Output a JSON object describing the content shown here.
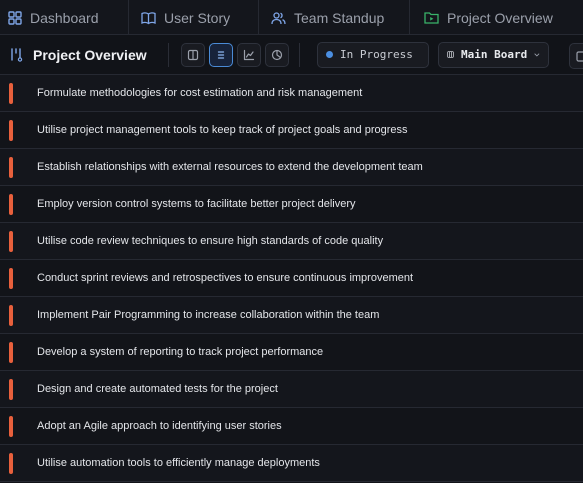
{
  "tabs": [
    {
      "label": "Dashboard",
      "icon": "grid-icon",
      "color": "#7fa6e8"
    },
    {
      "label": "User Story",
      "icon": "book-icon",
      "color": "#7fa6e8"
    },
    {
      "label": "Team Standup",
      "icon": "users-icon",
      "color": "#7fa6e8"
    },
    {
      "label": "Project Overview",
      "icon": "folder-play-icon",
      "color": "#39b36a"
    }
  ],
  "header": {
    "title": "Project Overview",
    "title_icon": "kanban-icon",
    "views": [
      "columns-view-icon",
      "list-view-icon",
      "chart-view-icon",
      "pie-view-icon"
    ],
    "active_view": "list-view-icon",
    "status": {
      "label": "In Progress",
      "color": "#4b8fe2"
    },
    "board": {
      "label": "Main Board"
    }
  },
  "tasks": [
    {
      "label": "Formulate methodologies for cost estimation and risk management",
      "color": "#e8603c"
    },
    {
      "label": "Utilise project management tools to keep track of project goals and progress",
      "color": "#e8603c"
    },
    {
      "label": "Establish relationships with external resources to extend the development team",
      "color": "#e8603c"
    },
    {
      "label": "Employ version control systems to facilitate better project delivery",
      "color": "#e8603c"
    },
    {
      "label": "Utilise code review techniques to ensure high standards of code quality",
      "color": "#e8603c"
    },
    {
      "label": "Conduct sprint reviews and retrospectives to ensure continuous improvement",
      "color": "#e8603c"
    },
    {
      "label": "Implement Pair Programming to increase collaboration within the team",
      "color": "#e8603c"
    },
    {
      "label": "Develop a system of reporting to track project performance",
      "color": "#e8603c"
    },
    {
      "label": "Design and create automated tests for the project",
      "color": "#e8603c"
    },
    {
      "label": "Adopt an Agile approach to identifying user stories",
      "color": "#e8603c"
    },
    {
      "label": "Utilise automation tools to efficiently manage deployments",
      "color": "#e8603c"
    }
  ]
}
